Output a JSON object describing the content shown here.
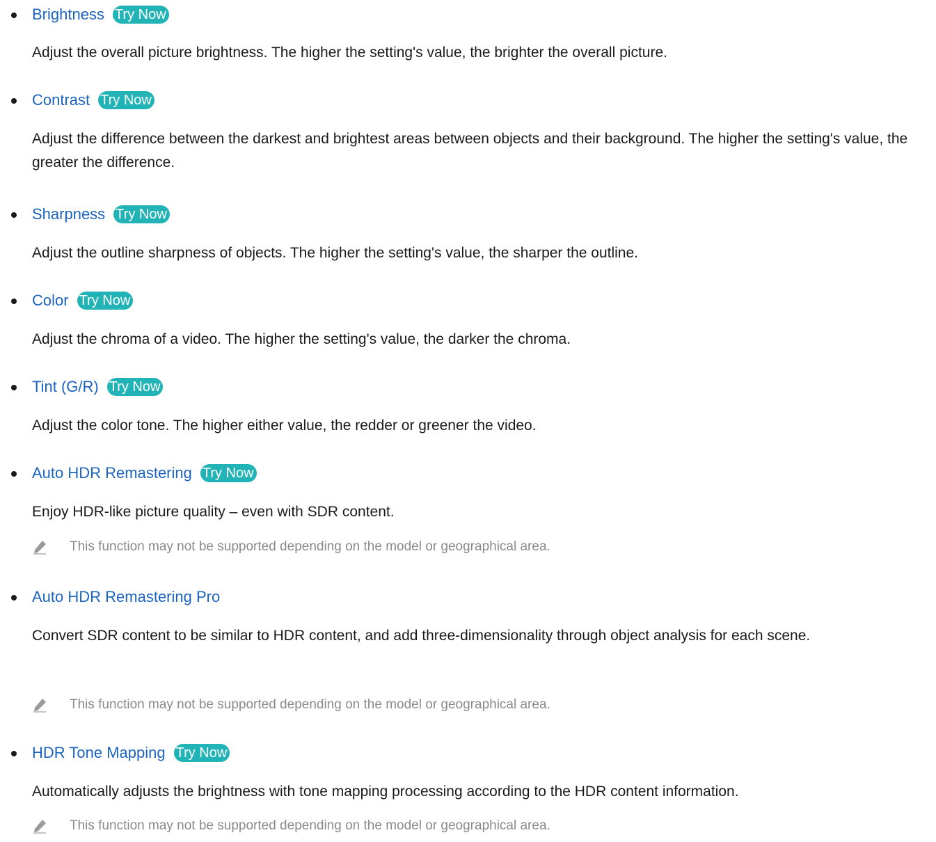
{
  "try_now": "Try Now",
  "items": [
    {
      "title": "Brightness",
      "desc": "Adjust the overall picture brightness. The higher the setting's value, the brighter the overall picture."
    },
    {
      "title": "Contrast",
      "desc": "Adjust the difference between the darkest and brightest areas between objects and their background. The higher the setting's value, the greater the difference."
    },
    {
      "title": "Sharpness",
      "desc": "Adjust the outline sharpness of objects. The higher the setting's value, the sharper the outline."
    },
    {
      "title": "Color",
      "desc": "Adjust the chroma of a video. The higher the setting's value, the darker the chroma."
    },
    {
      "title": "Tint (G/R)",
      "desc": "Adjust the color tone. The higher either value, the redder or greener the video."
    },
    {
      "title": "Auto HDR Remastering",
      "desc": "Enjoy HDR-like picture quality – even with SDR content.",
      "note": "This function may not be supported depending on the model or geographical area."
    },
    {
      "title": "Auto HDR Remastering Pro",
      "desc": "Convert SDR content to be similar to HDR content, and add three-dimensionality through object analysis for each scene.",
      "note": "This function may not be supported depending on the model or geographical area."
    },
    {
      "title": "HDR Tone Mapping",
      "desc": "Automatically adjusts the brightness with tone mapping processing according to the HDR content information.",
      "note": "This function may not be supported depending on the model or geographical area."
    }
  ]
}
